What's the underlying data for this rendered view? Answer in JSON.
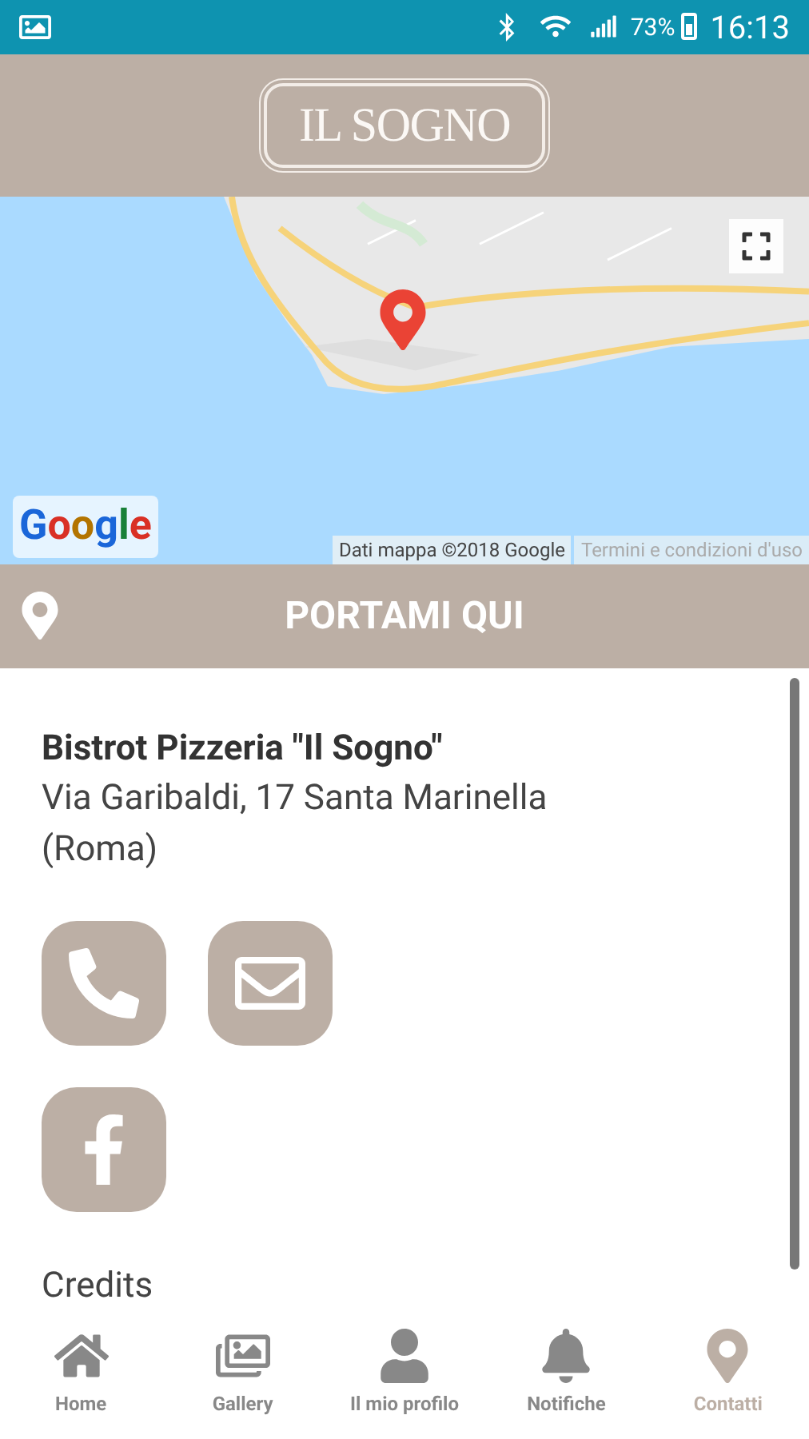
{
  "status_bar": {
    "battery": "73%",
    "time": "16:13"
  },
  "header": {
    "logo": "IL SOGNO"
  },
  "map": {
    "logo": "Google",
    "attribution": "Dati mappa ©2018 Google",
    "terms": "Termini e condizioni d'uso"
  },
  "directions_button": {
    "label": "PORTAMI QUI"
  },
  "venue": {
    "name": "Bistrot Pizzeria \"Il Sogno\"",
    "address": "Via Garibaldi, 17 Santa Marinella (Roma)"
  },
  "contact_buttons": [
    {
      "kind": "phone"
    },
    {
      "kind": "email"
    },
    {
      "kind": "facebook"
    }
  ],
  "credits": "Credits",
  "nav": [
    {
      "label": "Home",
      "kind": "home",
      "selected": false
    },
    {
      "label": "Gallery",
      "kind": "gallery",
      "selected": false
    },
    {
      "label": "Il mio profilo",
      "kind": "profile",
      "selected": false
    },
    {
      "label": "Notifiche",
      "kind": "notifications",
      "selected": false
    },
    {
      "label": "Contatti",
      "kind": "contacts",
      "selected": true
    }
  ]
}
